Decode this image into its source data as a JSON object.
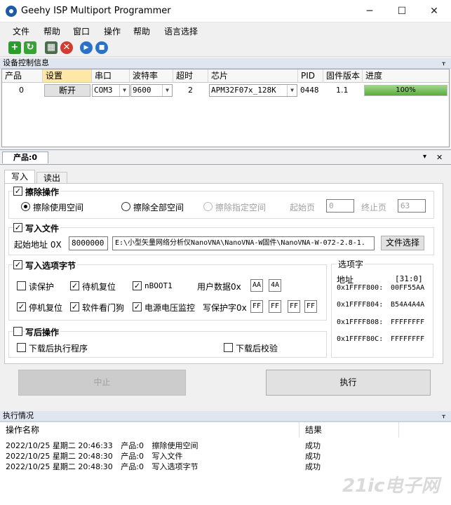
{
  "window": {
    "title": "Geehy ISP Multiport Programmer",
    "min": "─",
    "max": "☐",
    "close": "✕"
  },
  "menu": [
    "文件",
    "帮助",
    "窗口",
    "操作",
    "帮助",
    "语言选择"
  ],
  "toolbar": [
    {
      "icon": "plus-icon",
      "glyph": "+",
      "color": "#2e9b2e"
    },
    {
      "icon": "refresh-icon",
      "glyph": "↻",
      "color": "#3aa03a"
    },
    {
      "icon": "chip-settings-icon",
      "glyph": "▦",
      "color": "#4d6b4d"
    },
    {
      "icon": "stop-red-icon",
      "glyph": "✕",
      "color": "#d23b2f"
    },
    {
      "icon": "play-icon",
      "glyph": "▶",
      "color": "#2a72c8"
    },
    {
      "icon": "stop-icon",
      "glyph": "■",
      "color": "#2a72c8"
    }
  ],
  "device_section": {
    "title": "设备控制信息",
    "pin": "ᚁ"
  },
  "device_grid": {
    "headers": [
      "产品",
      "设置",
      "串口",
      "波特率",
      "超时",
      "芯片",
      "PID",
      "固件版本",
      "进度"
    ],
    "row": {
      "product": "0",
      "settings_button": "断开",
      "port": "COM3",
      "baud": "9600",
      "timeout": "2",
      "chip": "APM32F07x_128K",
      "pid": "0448",
      "firmware": "1.1",
      "progress_text": "100%",
      "progress": 1.0
    }
  },
  "product_tab": {
    "label": "产品:0",
    "dropdown": "▾",
    "close": "✕"
  },
  "subtabs": [
    "写入",
    "读出"
  ],
  "erase": {
    "title": "擦除操作",
    "options": [
      "擦除使用空间",
      "擦除全部空间",
      "擦除指定空间"
    ],
    "start_label": "起始页",
    "start_value": "0",
    "end_label": "终止页",
    "end_value": "63"
  },
  "write_file": {
    "title": "写入文件",
    "addr_label": "起始地址 0X",
    "addr_value": "8000000",
    "path": "E:\\小型矢量网络分析仪NanoVNA\\NanoVNA-W固件\\NanoVNA-W-072-2.8-1.",
    "select_button": "文件选择"
  },
  "option_bytes": {
    "title": "写入选项字节",
    "read_protect": "读保护",
    "standby_reset": "待机复位",
    "nboot1": "nBOOT1",
    "user_data_label": "用户数据0x",
    "user_data": [
      "AA",
      "4A"
    ],
    "stop_reset": "停机复位",
    "soft_watchdog": "软件看门狗",
    "power_monitor": "电源电压监控",
    "wp_label": "写保护字0x",
    "wp": [
      "FF",
      "FF",
      "FF",
      "FF"
    ]
  },
  "option_words": {
    "title": "选项字",
    "addr_header": "地址",
    "bits_header": "[31:0]",
    "rows": [
      {
        "addr": "0x1FFFF800:",
        "value": "00FF55AA"
      },
      {
        "addr": "0x1FFFF804:",
        "value": "B54A4A4A"
      },
      {
        "addr": "0x1FFFF808:",
        "value": "FFFFFFFF"
      },
      {
        "addr": "0x1FFFF80C:",
        "value": "FFFFFFFF"
      }
    ]
  },
  "post": {
    "title": "写后操作",
    "run_after": "下载后执行程序",
    "verify_after": "下载后校验"
  },
  "actions": {
    "abort": "中止",
    "execute": "执行"
  },
  "log_section": {
    "title": "执行情况",
    "pin": "ᚁ"
  },
  "log": {
    "headers": [
      "操作名称",
      "结果"
    ],
    "rows": [
      {
        "time": "2022/10/25 星期二 20:46:33",
        "product": "产品:0",
        "op": "擦除使用空间",
        "result": "成功"
      },
      {
        "time": "2022/10/25 星期二 20:48:30",
        "product": "产品:0",
        "op": "写入文件",
        "result": "成功"
      },
      {
        "time": "2022/10/25 星期二 20:48:30",
        "product": "产品:0",
        "op": "写入选项字节",
        "result": "成功"
      }
    ]
  },
  "watermark": "21ic电子网"
}
